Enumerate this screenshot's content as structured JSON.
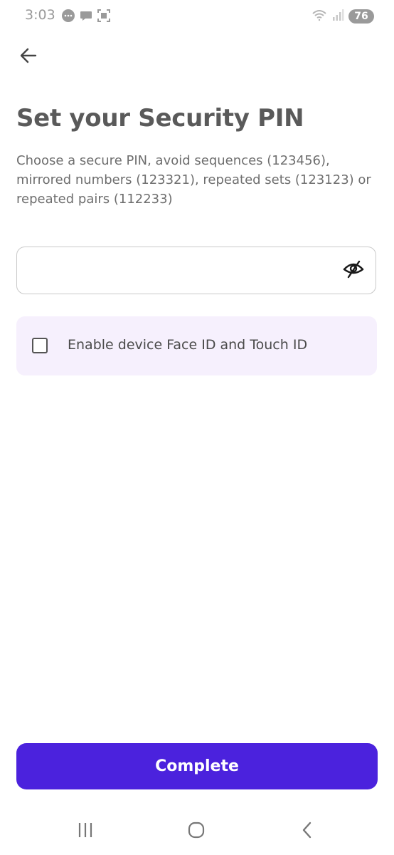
{
  "status_bar": {
    "time": "3:03",
    "left_icons": [
      "chat-bubble-icon",
      "message-icon",
      "screenshot-icon"
    ],
    "right_icons": [
      "wifi-icon",
      "signal-icon"
    ],
    "battery_level": "76"
  },
  "header": {
    "back_icon": "arrow-left-icon"
  },
  "main": {
    "title": "Set your Security PIN",
    "instructions": "Choose a secure PIN, avoid sequences (123456), mirrored numbers (123321), repeated sets (123123) or repeated pairs (112233)",
    "pin_input": {
      "value": "",
      "placeholder": "",
      "toggle_icon": "eye-off-icon"
    },
    "biometric_option": {
      "label": "Enable device Face ID and Touch ID",
      "checked": false
    }
  },
  "footer": {
    "complete_label": "Complete"
  },
  "nav_bar": {
    "buttons": [
      "recent-apps-icon",
      "home-icon",
      "back-nav-icon"
    ]
  },
  "colors": {
    "primary": "#4b22dd",
    "card_background": "#f6f0fd",
    "title_text": "#5a5a5a",
    "body_text": "#6e6e6e"
  }
}
